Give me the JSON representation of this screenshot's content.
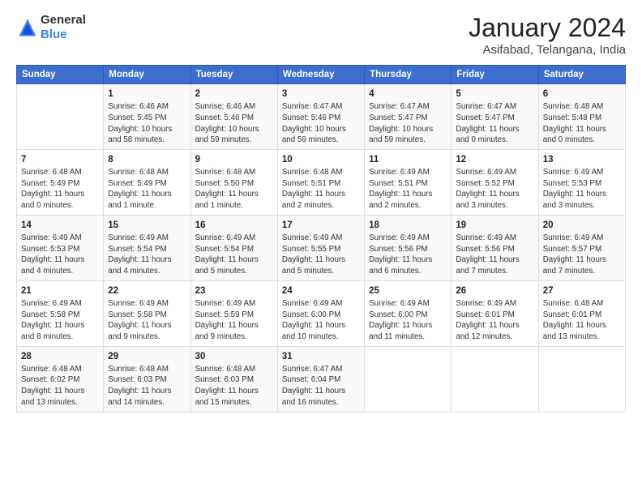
{
  "logo": {
    "line1": "General",
    "line2": "Blue"
  },
  "title": "January 2024",
  "location": "Asifabad, Telangana, India",
  "days_of_week": [
    "Sunday",
    "Monday",
    "Tuesday",
    "Wednesday",
    "Thursday",
    "Friday",
    "Saturday"
  ],
  "weeks": [
    [
      {
        "num": "",
        "info": ""
      },
      {
        "num": "1",
        "info": "Sunrise: 6:46 AM\nSunset: 5:45 PM\nDaylight: 10 hours\nand 58 minutes."
      },
      {
        "num": "2",
        "info": "Sunrise: 6:46 AM\nSunset: 5:46 PM\nDaylight: 10 hours\nand 59 minutes."
      },
      {
        "num": "3",
        "info": "Sunrise: 6:47 AM\nSunset: 5:46 PM\nDaylight: 10 hours\nand 59 minutes."
      },
      {
        "num": "4",
        "info": "Sunrise: 6:47 AM\nSunset: 5:47 PM\nDaylight: 10 hours\nand 59 minutes."
      },
      {
        "num": "5",
        "info": "Sunrise: 6:47 AM\nSunset: 5:47 PM\nDaylight: 11 hours\nand 0 minutes."
      },
      {
        "num": "6",
        "info": "Sunrise: 6:48 AM\nSunset: 5:48 PM\nDaylight: 11 hours\nand 0 minutes."
      }
    ],
    [
      {
        "num": "7",
        "info": "Sunrise: 6:48 AM\nSunset: 5:49 PM\nDaylight: 11 hours\nand 0 minutes."
      },
      {
        "num": "8",
        "info": "Sunrise: 6:48 AM\nSunset: 5:49 PM\nDaylight: 11 hours\nand 1 minute."
      },
      {
        "num": "9",
        "info": "Sunrise: 6:48 AM\nSunset: 5:50 PM\nDaylight: 11 hours\nand 1 minute."
      },
      {
        "num": "10",
        "info": "Sunrise: 6:48 AM\nSunset: 5:51 PM\nDaylight: 11 hours\nand 2 minutes."
      },
      {
        "num": "11",
        "info": "Sunrise: 6:49 AM\nSunset: 5:51 PM\nDaylight: 11 hours\nand 2 minutes."
      },
      {
        "num": "12",
        "info": "Sunrise: 6:49 AM\nSunset: 5:52 PM\nDaylight: 11 hours\nand 3 minutes."
      },
      {
        "num": "13",
        "info": "Sunrise: 6:49 AM\nSunset: 5:53 PM\nDaylight: 11 hours\nand 3 minutes."
      }
    ],
    [
      {
        "num": "14",
        "info": "Sunrise: 6:49 AM\nSunset: 5:53 PM\nDaylight: 11 hours\nand 4 minutes."
      },
      {
        "num": "15",
        "info": "Sunrise: 6:49 AM\nSunset: 5:54 PM\nDaylight: 11 hours\nand 4 minutes."
      },
      {
        "num": "16",
        "info": "Sunrise: 6:49 AM\nSunset: 5:54 PM\nDaylight: 11 hours\nand 5 minutes."
      },
      {
        "num": "17",
        "info": "Sunrise: 6:49 AM\nSunset: 5:55 PM\nDaylight: 11 hours\nand 5 minutes."
      },
      {
        "num": "18",
        "info": "Sunrise: 6:49 AM\nSunset: 5:56 PM\nDaylight: 11 hours\nand 6 minutes."
      },
      {
        "num": "19",
        "info": "Sunrise: 6:49 AM\nSunset: 5:56 PM\nDaylight: 11 hours\nand 7 minutes."
      },
      {
        "num": "20",
        "info": "Sunrise: 6:49 AM\nSunset: 5:57 PM\nDaylight: 11 hours\nand 7 minutes."
      }
    ],
    [
      {
        "num": "21",
        "info": "Sunrise: 6:49 AM\nSunset: 5:58 PM\nDaylight: 11 hours\nand 8 minutes."
      },
      {
        "num": "22",
        "info": "Sunrise: 6:49 AM\nSunset: 5:58 PM\nDaylight: 11 hours\nand 9 minutes."
      },
      {
        "num": "23",
        "info": "Sunrise: 6:49 AM\nSunset: 5:59 PM\nDaylight: 11 hours\nand 9 minutes."
      },
      {
        "num": "24",
        "info": "Sunrise: 6:49 AM\nSunset: 6:00 PM\nDaylight: 11 hours\nand 10 minutes."
      },
      {
        "num": "25",
        "info": "Sunrise: 6:49 AM\nSunset: 6:00 PM\nDaylight: 11 hours\nand 11 minutes."
      },
      {
        "num": "26",
        "info": "Sunrise: 6:49 AM\nSunset: 6:01 PM\nDaylight: 11 hours\nand 12 minutes."
      },
      {
        "num": "27",
        "info": "Sunrise: 6:48 AM\nSunset: 6:01 PM\nDaylight: 11 hours\nand 13 minutes."
      }
    ],
    [
      {
        "num": "28",
        "info": "Sunrise: 6:48 AM\nSunset: 6:02 PM\nDaylight: 11 hours\nand 13 minutes."
      },
      {
        "num": "29",
        "info": "Sunrise: 6:48 AM\nSunset: 6:03 PM\nDaylight: 11 hours\nand 14 minutes."
      },
      {
        "num": "30",
        "info": "Sunrise: 6:48 AM\nSunset: 6:03 PM\nDaylight: 11 hours\nand 15 minutes."
      },
      {
        "num": "31",
        "info": "Sunrise: 6:47 AM\nSunset: 6:04 PM\nDaylight: 11 hours\nand 16 minutes."
      },
      {
        "num": "",
        "info": ""
      },
      {
        "num": "",
        "info": ""
      },
      {
        "num": "",
        "info": ""
      }
    ]
  ]
}
